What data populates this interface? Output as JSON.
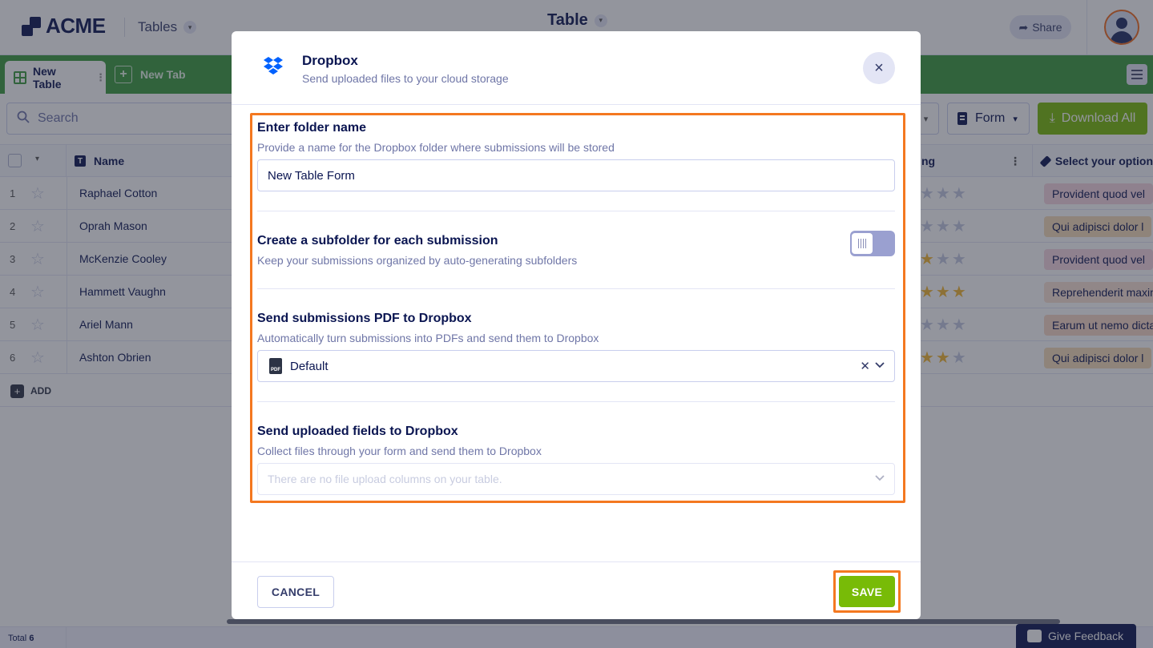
{
  "app": {
    "logo_text": "ACME",
    "tables_label": "Tables",
    "table_title": "Table",
    "share_label": "Share"
  },
  "tabs": {
    "active_label": "New Table",
    "new_tab_label": "New Tab"
  },
  "toolbar": {
    "search_placeholder": "Search",
    "form_label": "Form",
    "download_label": "Download All"
  },
  "grid": {
    "columns": {
      "name": "Name",
      "rating_partial": "ng",
      "select": "Select your option"
    },
    "rows": [
      {
        "num": "1",
        "name": "Raphael Cotton",
        "stars": 0,
        "tag": "Provident quod vel"
      },
      {
        "num": "2",
        "name": "Oprah Mason",
        "stars": 0,
        "tag": "Qui adipisci dolor l"
      },
      {
        "num": "3",
        "name": "McKenzie Cooley",
        "stars": 1,
        "tag": "Provident quod vel"
      },
      {
        "num": "4",
        "name": "Hammett Vaughn",
        "stars": 3,
        "tag": "Reprehenderit maxim"
      },
      {
        "num": "5",
        "name": "Ariel Mann",
        "stars": 0,
        "tag": "Earum ut nemo dicta"
      },
      {
        "num": "6",
        "name": "Ashton Obrien",
        "stars": 2,
        "tag": "Qui adipisci dolor l"
      }
    ],
    "add_label": "ADD",
    "total_label": "Total",
    "total_count": "6"
  },
  "feedback_label": "Give Feedback",
  "modal": {
    "title": "Dropbox",
    "subtitle": "Send uploaded files to your cloud storage",
    "folder": {
      "title": "Enter folder name",
      "desc": "Provide a name for the Dropbox folder where submissions will be stored",
      "value": "New Table Form"
    },
    "subfolder": {
      "title": "Create a subfolder for each submission",
      "desc": "Keep your submissions organized by auto-generating subfolders",
      "enabled": false
    },
    "pdf": {
      "title": "Send submissions PDF to Dropbox",
      "desc": "Automatically turn submissions into PDFs and send them to Dropbox",
      "selected": "Default"
    },
    "uploads": {
      "title": "Send uploaded fields to Dropbox",
      "desc": "Collect files through your form and send them to Dropbox",
      "placeholder": "There are no file upload columns on your table."
    },
    "cancel_label": "CANCEL",
    "save_label": "SAVE"
  },
  "colors": {
    "accent_green": "#78bb07",
    "tab_green": "#3b9a3d",
    "navy": "#0a1551",
    "highlight_orange": "#f47820",
    "dropbox_blue": "#0061fe",
    "star_gold": "#f2b631"
  }
}
